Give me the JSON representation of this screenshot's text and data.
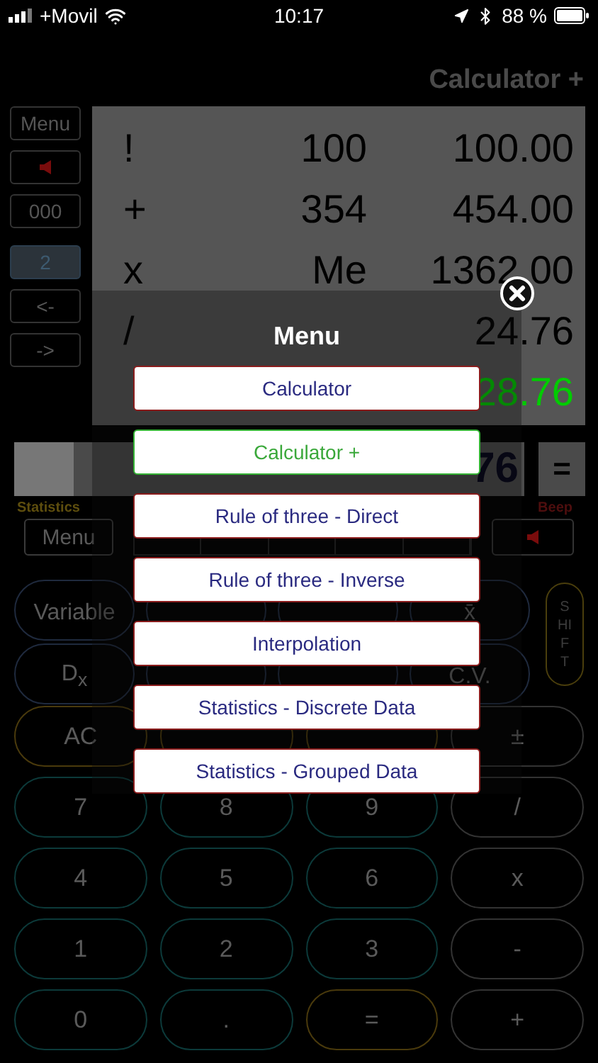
{
  "status_bar": {
    "carrier": "+Movil",
    "time": "10:17",
    "battery": "88 %"
  },
  "title": "Calculator +",
  "side_buttons": [
    {
      "kind": "text",
      "label": "Menu",
      "selected": false
    },
    {
      "kind": "speaker",
      "selected": false
    },
    {
      "kind": "text",
      "label": "000",
      "selected": false
    },
    {
      "kind": "text",
      "label": "2",
      "selected": true
    },
    {
      "kind": "text",
      "label": "<-",
      "selected": false
    },
    {
      "kind": "text",
      "label": "->",
      "selected": false
    }
  ],
  "tape": [
    {
      "kind": "step",
      "op": "!",
      "value": "100",
      "result": "100.00"
    },
    {
      "kind": "step",
      "op": "+",
      "value": "354",
      "result": "454.00"
    },
    {
      "kind": "step",
      "op": "x",
      "value": "Me",
      "result": "1362.00"
    },
    {
      "kind": "step",
      "op": "/",
      "result": "24.76"
    },
    {
      "kind": "total",
      "result": "28.76"
    }
  ],
  "display": {
    "value": "76",
    "equals": "="
  },
  "mode_label": "Statistics",
  "beep_label": "Beep",
  "toolbar": {
    "menu": "Menu"
  },
  "keypad_top": [
    [
      {
        "kind": "function",
        "label": "Variable"
      },
      {
        "kind": "function"
      },
      {
        "kind": "function"
      },
      {
        "kind": "function",
        "label": "x̄"
      }
    ],
    [
      {
        "kind": "function",
        "label": "D$_{x}$"
      },
      {
        "kind": "function"
      },
      {
        "kind": "function"
      },
      {
        "kind": "function",
        "label": "C.V."
      }
    ]
  ],
  "shift": "SHIFT",
  "keypad": [
    [
      {
        "kind": "clear",
        "label": "AC"
      },
      {
        "kind": "clear"
      },
      {
        "kind": "clear"
      },
      {
        "kind": "operator",
        "label": "±"
      }
    ],
    [
      {
        "kind": "digit",
        "label": "7"
      },
      {
        "kind": "digit",
        "label": "8"
      },
      {
        "kind": "digit",
        "label": "9"
      },
      {
        "kind": "operator",
        "label": "/"
      }
    ],
    [
      {
        "kind": "digit",
        "label": "4"
      },
      {
        "kind": "digit",
        "label": "5"
      },
      {
        "kind": "digit",
        "label": "6"
      },
      {
        "kind": "operator",
        "label": "x"
      }
    ],
    [
      {
        "kind": "digit",
        "label": "1"
      },
      {
        "kind": "digit",
        "label": "2"
      },
      {
        "kind": "digit",
        "label": "3"
      },
      {
        "kind": "operator",
        "label": "-"
      }
    ],
    [
      {
        "kind": "digit",
        "label": "0"
      },
      {
        "kind": "digit",
        "label": "."
      },
      {
        "kind": "equals",
        "label": "="
      },
      {
        "kind": "operator",
        "label": "+"
      }
    ]
  ],
  "menu": {
    "title": "Menu",
    "items": [
      {
        "label": "Calculator",
        "selected": false
      },
      {
        "label": "Calculator +",
        "selected": true
      },
      {
        "label": "Rule of three - Direct",
        "selected": false
      },
      {
        "label": "Rule of three - Inverse",
        "selected": false
      },
      {
        "label": "Interpolation",
        "selected": false
      },
      {
        "label": "Statistics - Discrete Data",
        "selected": false
      },
      {
        "label": "Statistics - Grouped Data",
        "selected": false
      }
    ]
  }
}
